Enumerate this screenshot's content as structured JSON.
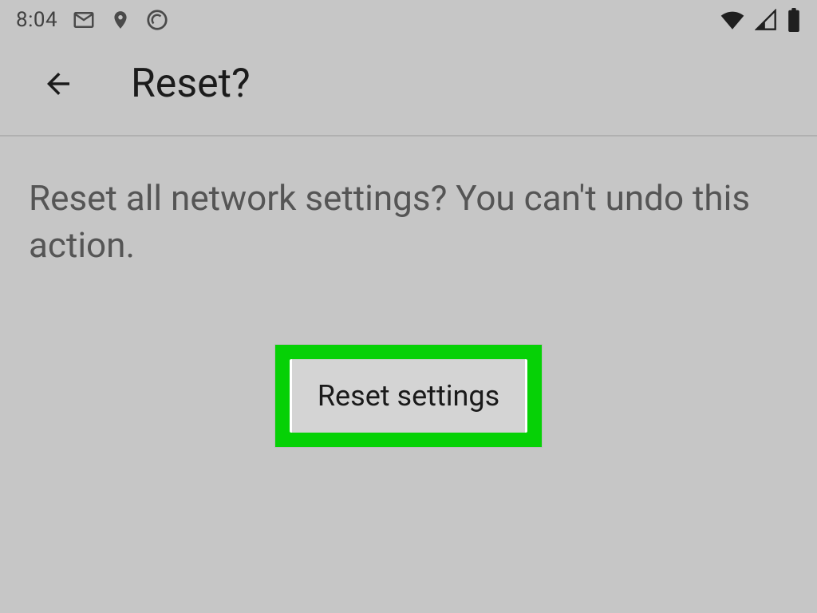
{
  "status_bar": {
    "time": "8:04"
  },
  "app_bar": {
    "title": "Reset?"
  },
  "content": {
    "warning": "Reset all network settings? You can't undo this action."
  },
  "button": {
    "label": "Reset settings"
  },
  "colors": {
    "highlight": "#06d106"
  }
}
